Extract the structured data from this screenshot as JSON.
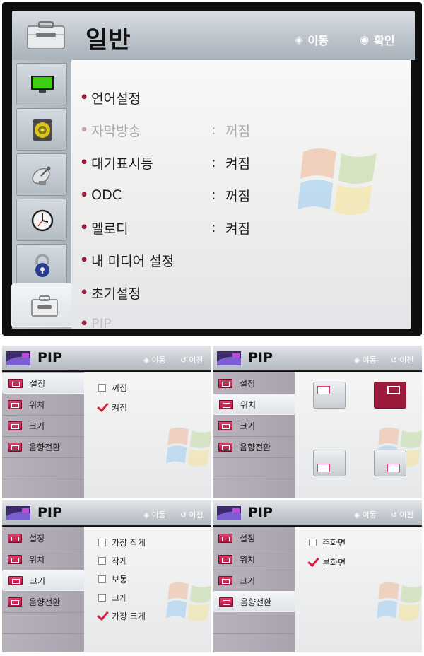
{
  "top": {
    "title": "일반",
    "hint_move": "이동",
    "hint_ok": "확인",
    "icons": [
      "tv-icon",
      "speaker-icon",
      "satellite-icon",
      "clock-icon",
      "lock-icon",
      "toolbox-icon"
    ],
    "menu": [
      {
        "label": "언어설정",
        "value": "",
        "dim": false
      },
      {
        "label": "자막방송",
        "value": "꺼짐",
        "dim": true
      },
      {
        "label": "대기표시등",
        "value": "켜짐",
        "dim": false
      },
      {
        "label": "ODC",
        "value": "꺼짐",
        "dim": false
      },
      {
        "label": "멜로디",
        "value": "켜짐",
        "dim": false
      },
      {
        "label": "내 미디어 설정",
        "value": "",
        "dim": false
      },
      {
        "label": "초기설정",
        "value": "",
        "dim": false
      },
      {
        "label": "PIP",
        "value": "",
        "dim": true
      }
    ]
  },
  "pip": {
    "title": "PIP",
    "hint_move": "이동",
    "hint_back": "이전",
    "side": [
      "설정",
      "위치",
      "크기",
      "음향전환"
    ],
    "setting_options": [
      {
        "label": "꺼짐",
        "checked": false
      },
      {
        "label": "켜짐",
        "checked": true
      }
    ],
    "size_options": [
      {
        "label": "가장 작게",
        "checked": false
      },
      {
        "label": "작게",
        "checked": false
      },
      {
        "label": "보통",
        "checked": false
      },
      {
        "label": "크게",
        "checked": false
      },
      {
        "label": "가장 크게",
        "checked": true
      }
    ],
    "sound_options": [
      {
        "label": "주화면",
        "checked": false
      },
      {
        "label": "부화면",
        "checked": true
      }
    ],
    "position_selected": "top-right"
  },
  "colors": {
    "accent": "#9c1a3a",
    "check": "#d51f3f"
  }
}
